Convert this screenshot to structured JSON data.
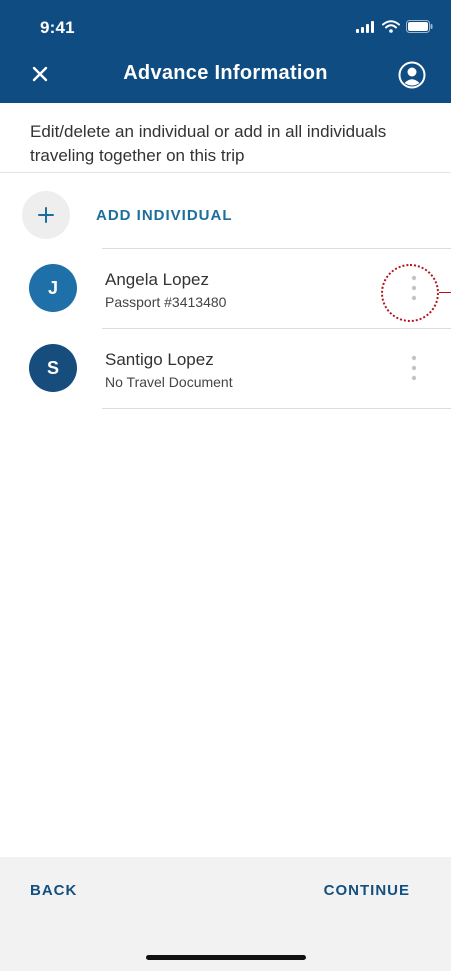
{
  "status_bar": {
    "time": "9:41"
  },
  "nav": {
    "title": "Advance Information",
    "close_icon": "close-icon",
    "account_icon": "account-circle-icon"
  },
  "instructions": "Edit/delete an individual or add in all individuals traveling together on this trip",
  "add_individual": {
    "icon": "plus-icon",
    "label": "ADD INDIVIDUAL"
  },
  "individuals": [
    {
      "initial": "J",
      "name": "Angela Lopez",
      "document": "Passport #3413480",
      "avatar_color": "#1f6fa8"
    },
    {
      "initial": "S",
      "name": "Santigo Lopez",
      "document": "No Travel Document",
      "avatar_color": "#174d7c"
    }
  ],
  "footer": {
    "back_label": "BACK",
    "continue_label": "CONTINUE"
  },
  "colors": {
    "header_bg": "#0f4c81",
    "accent": "#1c6f9c",
    "footer_text": "#14507f",
    "highlight": "#b3141b"
  }
}
